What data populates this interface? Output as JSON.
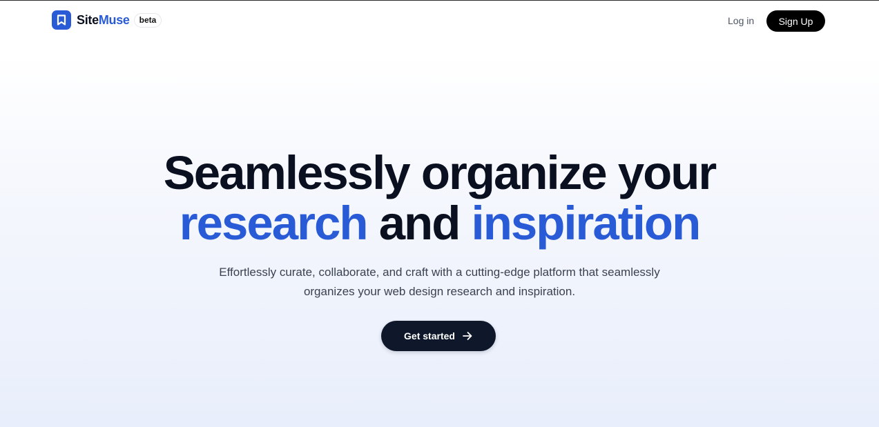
{
  "header": {
    "brand_site": "Site",
    "brand_muse": "Muse",
    "badge": "beta",
    "login_label": "Log in",
    "signup_label": "Sign Up"
  },
  "hero": {
    "title_line1": "Seamlessly organize your",
    "title_accent1": "research",
    "title_mid": "and",
    "title_accent2": "inspiration",
    "subtitle_line1": "Effortlessly curate, collaborate, and craft with a cutting-edge platform that seamlessly",
    "subtitle_line2": "organizes your web design research and inspiration.",
    "cta_label": "Get started"
  },
  "icons": {
    "logo": "bookmark-icon",
    "cta": "arrow-right-icon"
  },
  "colors": {
    "accent": "#2a5bd7",
    "text_dark": "#0b1020",
    "cta_bg": "#0f172a",
    "signup_bg": "#000000"
  }
}
